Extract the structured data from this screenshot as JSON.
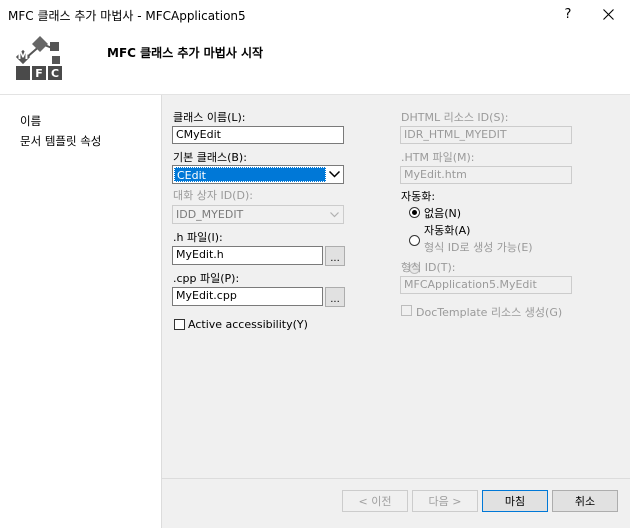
{
  "window": {
    "title": "MFC 클래스 추가 마법사 - MFCApplication5",
    "help_label": "?",
    "close_label": "✕"
  },
  "header": {
    "title": "MFC 클래스 추가 마법사 시작",
    "logo_letters": [
      "M",
      "F",
      "C"
    ]
  },
  "sidebar": {
    "items": [
      {
        "label": "이름"
      },
      {
        "label": "문서 템플릿 속성"
      }
    ]
  },
  "form": {
    "class_name_label": "클래스 이름(L):",
    "class_name_value": "CMyEdit",
    "base_class_label": "기본 클래스(B):",
    "base_class_value": "CEdit",
    "dialog_id_label": "대화 상자 ID(D):",
    "dialog_id_value": "IDD_MYEDIT",
    "h_file_label": ".h 파일(I):",
    "h_file_value": "MyEdit.h",
    "h_browse_label": "...",
    "cpp_file_label": ".cpp 파일(P):",
    "cpp_file_value": "MyEdit.cpp",
    "cpp_browse_label": "...",
    "active_accessibility_label": "Active accessibility(Y)",
    "dhtml_id_label": "DHTML 리소스 ID(S):",
    "dhtml_id_value": "IDR_HTML_MYEDIT",
    "htm_file_label": ".HTM 파일(M):",
    "htm_file_value": "MyEdit.htm",
    "automation_label": "자동화:",
    "radio_none_label": "없음(N)",
    "radio_automation_label": "자동화(A)",
    "radio_creatable_label": "형식 ID로 생성 가능(E)",
    "type_id_label": "형식 ID(T):",
    "type_id_value": "MFCApplication5.MyEdit",
    "doctemplate_label": "DocTemplate 리소스 생성(G)"
  },
  "footer": {
    "prev_label": "< 이전",
    "next_label": "다음 >",
    "finish_label": "마침",
    "cancel_label": "취소"
  }
}
